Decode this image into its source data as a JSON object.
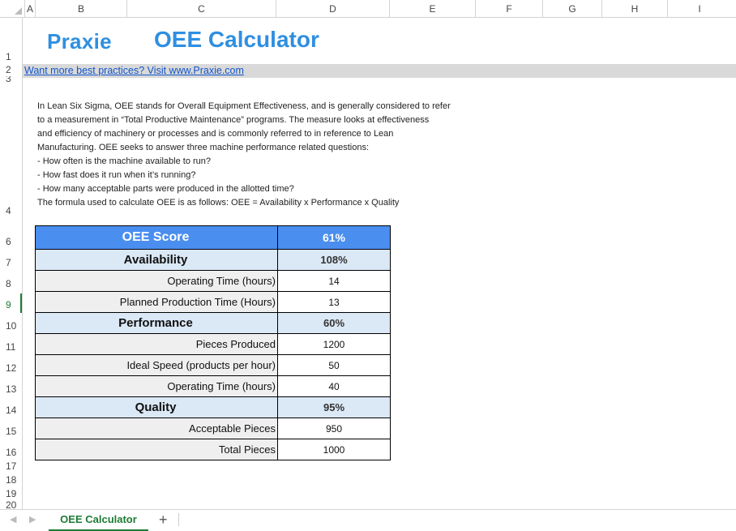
{
  "columns": [
    "A",
    "B",
    "C",
    "D",
    "E",
    "F",
    "G",
    "H",
    "I"
  ],
  "rows": [
    "1",
    "2",
    "3",
    "4",
    "6",
    "7",
    "8",
    "9",
    "10",
    "11",
    "12",
    "13",
    "14",
    "15",
    "16",
    "17",
    "18",
    "19",
    "20"
  ],
  "logo": "Praxie",
  "title": "OEE Calculator",
  "link_text": "Want more best practices? Visit www.Praxie.com",
  "description": [
    "In Lean Six Sigma, OEE stands for Overall Equipment Effectiveness, and is generally considered to refer",
    "to a measurement in “Total Productive Maintenance” programs. The measure looks at effectiveness",
    "and efficiency of machinery or processes and is commonly referred to in reference to Lean",
    "Manufacturing. OEE seeks to answer three machine performance related questions:",
    "- How often is the machine available to run?",
    "- How fast does it run when it’s running?",
    "- How many acceptable parts were produced in the allotted time?",
    "The formula used to calculate OEE is as follows: OEE = Availability x Performance x Quality"
  ],
  "table": {
    "score": {
      "label": "OEE Score",
      "value": "61%"
    },
    "availability": {
      "label": "Availability",
      "value": "108%"
    },
    "operating_time_1": {
      "label": "Operating Time (hours)",
      "value": "14"
    },
    "planned_time": {
      "label": "Planned Production Time (Hours)",
      "value": "13"
    },
    "performance": {
      "label": "Performance",
      "value": "60%"
    },
    "pieces_produced": {
      "label": "Pieces Produced",
      "value": "1200"
    },
    "ideal_speed": {
      "label": "Ideal Speed (products per hour)",
      "value": "50"
    },
    "operating_time_2": {
      "label": "Operating Time (hours)",
      "value": "40"
    },
    "quality": {
      "label": "Quality",
      "value": "95%"
    },
    "acceptable_pieces": {
      "label": "Acceptable Pieces",
      "value": "950"
    },
    "total_pieces": {
      "label": "Total Pieces",
      "value": "1000"
    }
  },
  "sheet_tab": "OEE Calculator",
  "add_tab": "+",
  "colors": {
    "accent": "#2f8fe0",
    "score_bg": "#4a8ef0",
    "section_bg": "#dbe8f6",
    "active_tab": "#1e7b34"
  }
}
